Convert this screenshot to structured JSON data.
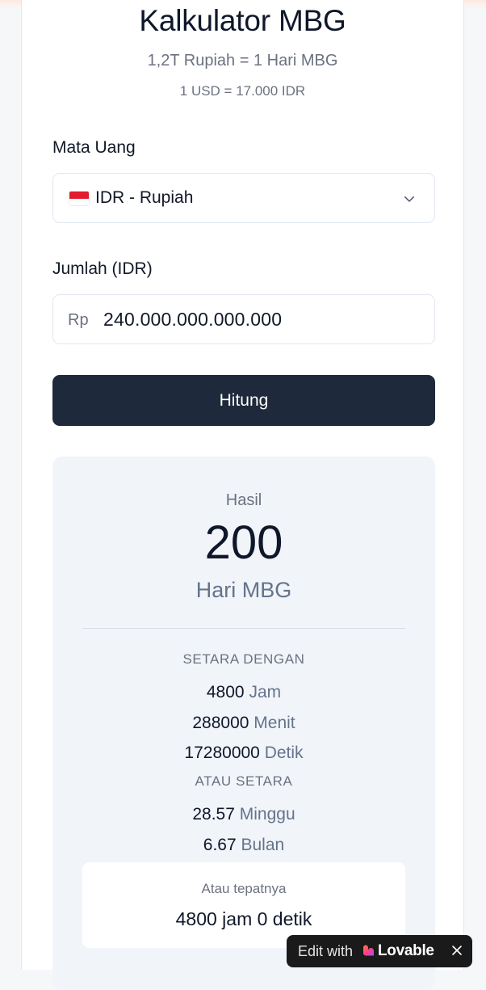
{
  "header": {
    "title": "Kalkulator MBG",
    "subtitle": "1,2T Rupiah = 1 Hari MBG",
    "rate": "1 USD = 17.000 IDR"
  },
  "form": {
    "currency_label": "Mata Uang",
    "currency_value": "IDR - Rupiah",
    "amount_label": "Jumlah (IDR)",
    "amount_prefix": "Rp",
    "amount_value": "240.000.000.000.000",
    "submit_label": "Hitung"
  },
  "result": {
    "label": "Hasil",
    "value": "200",
    "unit": "Hari MBG",
    "equivalent_heading": "SETARA DENGAN",
    "equivalents": [
      {
        "value": "4800",
        "unit": "Jam"
      },
      {
        "value": "288000",
        "unit": "Menit"
      },
      {
        "value": "17280000",
        "unit": "Detik"
      }
    ],
    "alt_heading": "ATAU SETARA",
    "alternatives": [
      {
        "value": "28.57",
        "unit": "Minggu"
      },
      {
        "value": "6.67",
        "unit": "Bulan"
      }
    ],
    "exact_label": "Atau tepatnya",
    "exact_value": "4800 jam 0 detik"
  },
  "badge": {
    "prefix": "Edit with",
    "brand": "Lovable"
  },
  "icons": {
    "flag": "indonesia-flag-icon",
    "dropdown": "chevron-down-icon",
    "brand": "lovable-heart-icon",
    "close": "close-icon"
  },
  "colors": {
    "primary_button": "#1e293b",
    "result_background": "#f1f4f9",
    "muted_text": "#6b7280"
  }
}
